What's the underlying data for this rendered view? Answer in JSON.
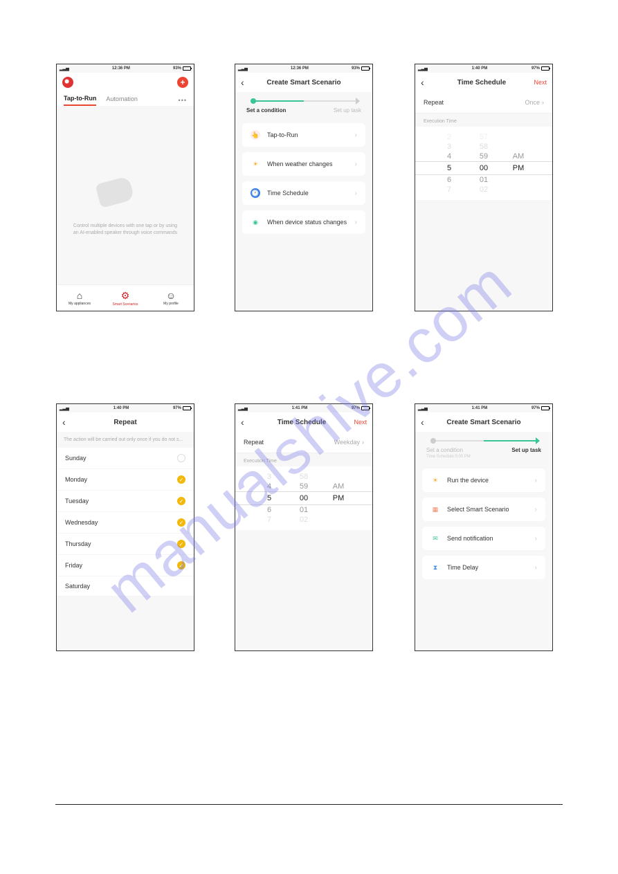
{
  "watermark": "manualshive.com",
  "screens": {
    "s1": {
      "status": {
        "time": "12:36 PM",
        "batt": "93%"
      },
      "tabs": {
        "active": "Tap-to-Run",
        "other": "Automation"
      },
      "empty": {
        "line1": "Control multiple devices with one tap or by using",
        "line2": "an AI-enabled speaker through voice commands"
      },
      "tabbar": {
        "a": "My appliances",
        "b": "Smart Scenarios",
        "c": "My profile"
      }
    },
    "s2": {
      "status": {
        "time": "12:36 PM",
        "batt": "93%"
      },
      "title": "Create Smart Scenario",
      "step1": "Set a condition",
      "step2": "Set up task",
      "items": {
        "a": "Tap-to-Run",
        "b": "When weather changes",
        "c": "Time Schedule",
        "d": "When device status changes"
      }
    },
    "s3": {
      "status": {
        "time": "1:40 PM",
        "batt": "97%"
      },
      "title": "Time Schedule",
      "next": "Next",
      "repeat_label": "Repeat",
      "repeat_val": "Once",
      "exec": "Execution Time",
      "picker": {
        "r1h": "2",
        "r1m": "57",
        "r1a": "",
        "r2h": "3",
        "r2m": "58",
        "r2a": "",
        "r3h": "4",
        "r3m": "59",
        "r3a": "AM",
        "selh": "5",
        "selm": "00",
        "sela": "PM",
        "r5h": "6",
        "r5m": "01",
        "r5a": "",
        "r6h": "7",
        "r6m": "02",
        "r6a": ""
      }
    },
    "s4": {
      "status": {
        "time": "1:40 PM",
        "batt": "97%"
      },
      "title": "Repeat",
      "hint": "The action will be carried out only once if you do not s...",
      "days": {
        "sun": "Sunday",
        "mon": "Monday",
        "tue": "Tuesday",
        "wed": "Wednesday",
        "thu": "Thursday",
        "fri": "Friday",
        "sat": "Saturday"
      }
    },
    "s5": {
      "status": {
        "time": "1:41 PM",
        "batt": "97%"
      },
      "title": "Time Schedule",
      "next": "Next",
      "repeat_label": "Repeat",
      "repeat_val": "Weekday",
      "exec": "Execution Time",
      "picker": {
        "r2h": "3",
        "r2m": "58",
        "r2a": "",
        "r3h": "4",
        "r3m": "59",
        "r3a": "AM",
        "selh": "5",
        "selm": "00",
        "sela": "PM",
        "r5h": "6",
        "r5m": "01",
        "r5a": "",
        "r6h": "7",
        "r6m": "02",
        "r6a": ""
      }
    },
    "s6": {
      "status": {
        "time": "1:41 PM",
        "batt": "97%"
      },
      "title": "Create Smart Scenario",
      "step1": "Set a condition",
      "step2": "Set up task",
      "note": "Time Schedule:5:00 PM",
      "items": {
        "a": "Run the device",
        "b": "Select Smart Scenario",
        "c": "Send notification",
        "d": "Time Delay"
      }
    }
  }
}
